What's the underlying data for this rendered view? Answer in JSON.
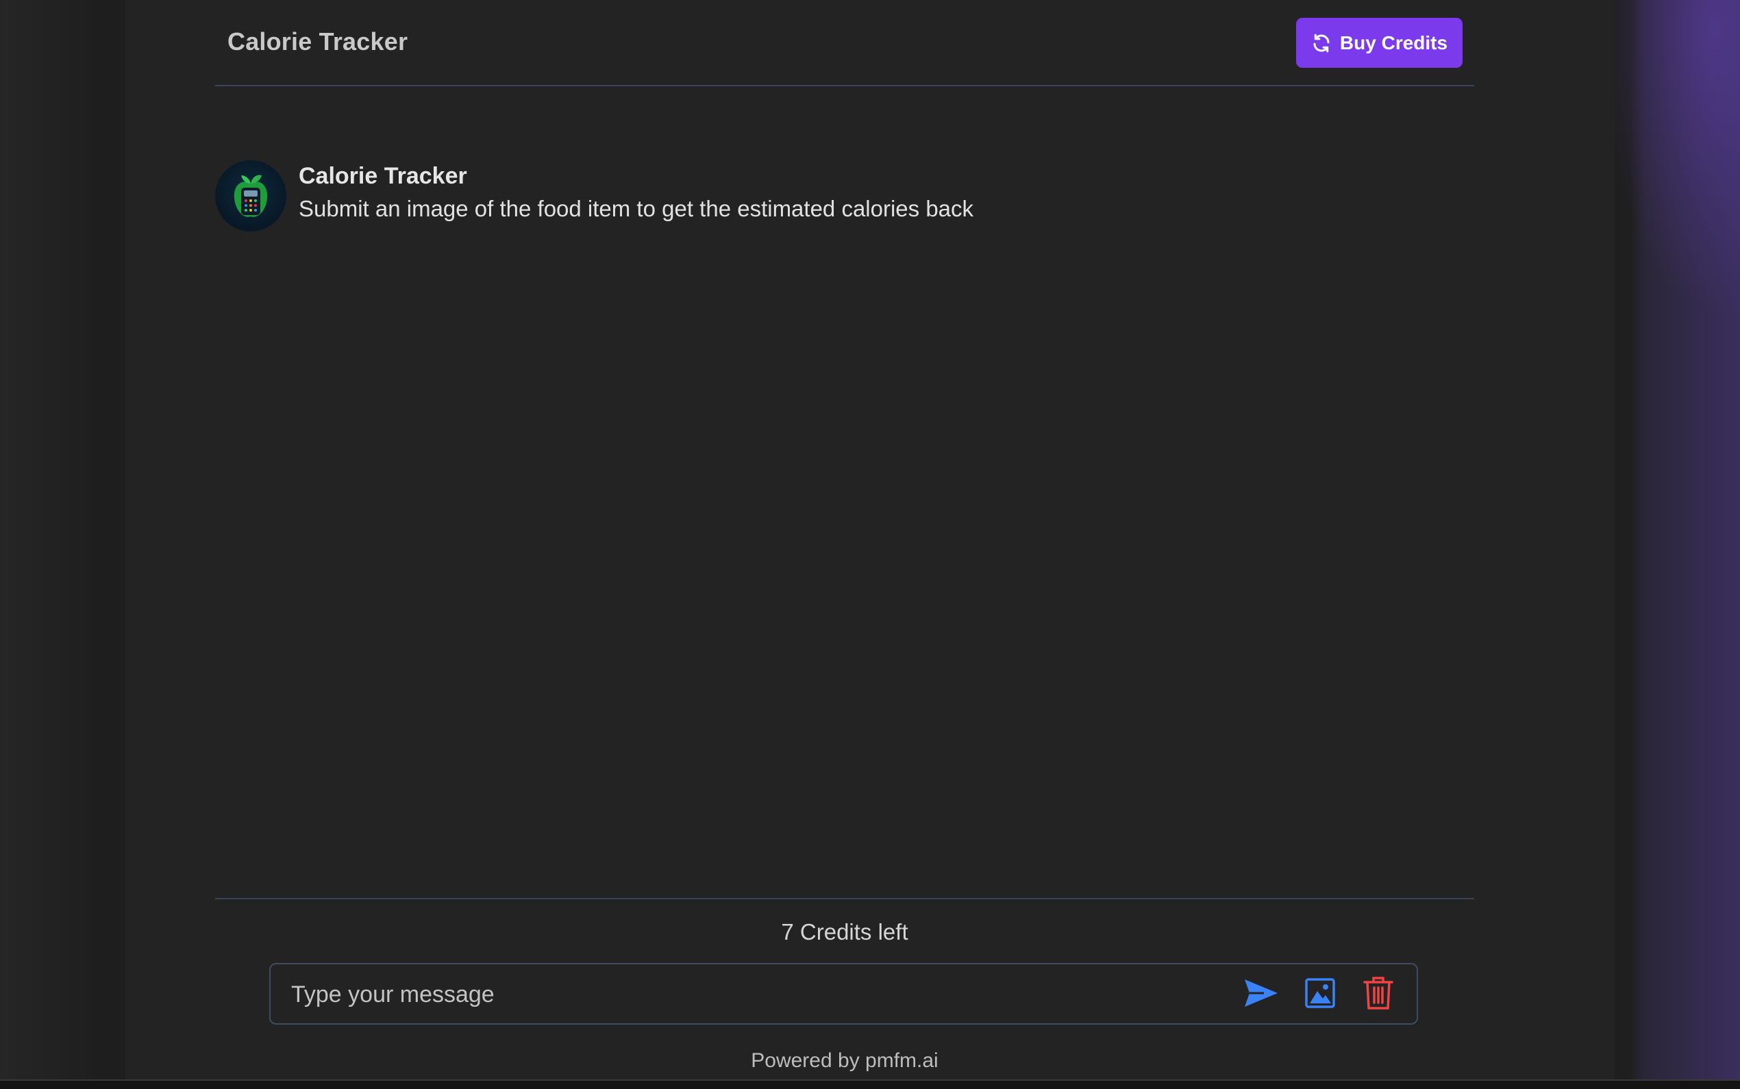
{
  "header": {
    "title": "Calorie Tracker",
    "buy_credits_label": "Buy Credits"
  },
  "chat": {
    "messages": [
      {
        "author": "Calorie Tracker",
        "text": "Submit an image of the food item to get the estimated calories back",
        "avatar_icon": "calorie-tracker-logo-icon"
      }
    ]
  },
  "footer": {
    "credits_text": "7 Credits left",
    "input_placeholder": "Type your message",
    "input_value": "",
    "powered_by": "Powered by pmfm.ai"
  },
  "icons": {
    "buy_credits": "refresh-icon",
    "send": "send-icon",
    "image": "image-icon",
    "delete": "trash-icon"
  },
  "colors": {
    "accent": "#7c3aed",
    "send": "#3b82f6",
    "image": "#3b82f6",
    "delete": "#ef4444",
    "background": "#232323",
    "divider": "#3a4658"
  }
}
